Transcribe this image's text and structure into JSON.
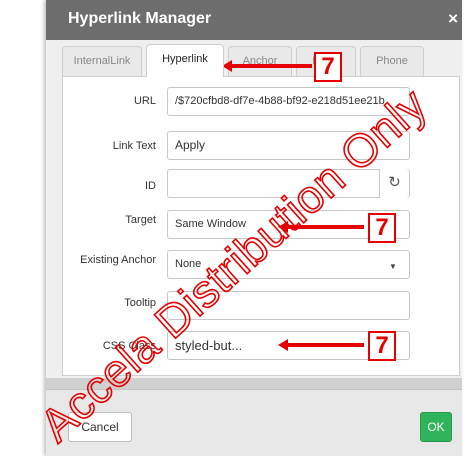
{
  "dialog": {
    "title": "Hyperlink Manager",
    "close_icon": "×"
  },
  "tabs": [
    {
      "label": "InternalLink",
      "active": false
    },
    {
      "label": "Hyperlink",
      "active": true
    },
    {
      "label": "Anchor",
      "active": false
    },
    {
      "label": "Email",
      "active": false
    },
    {
      "label": "Phone",
      "active": false
    }
  ],
  "form": {
    "url": {
      "label": "URL",
      "value": "/$720cfbd8-df7e-4b88-bf92-e218d51ee21b"
    },
    "link_text": {
      "label": "Link Text",
      "value": "Apply"
    },
    "id": {
      "label": "ID",
      "value": "",
      "reset_icon": "↻"
    },
    "target": {
      "label": "Target",
      "value": "Same Window"
    },
    "existing_anchor": {
      "label": "Existing Anchor",
      "value": "None"
    },
    "tooltip": {
      "label": "Tooltip",
      "value": ""
    },
    "css_class": {
      "label": "CSS Class",
      "value": "styled-but..."
    }
  },
  "footer": {
    "cancel_label": "Cancel",
    "ok_label": "OK"
  },
  "annotations": {
    "callout_number": "7",
    "watermark": "Accela Distribution Only",
    "callout_color": "#e60000"
  },
  "colors": {
    "titlebar": "#6d6d6d",
    "ok_button": "#2fb45c"
  }
}
